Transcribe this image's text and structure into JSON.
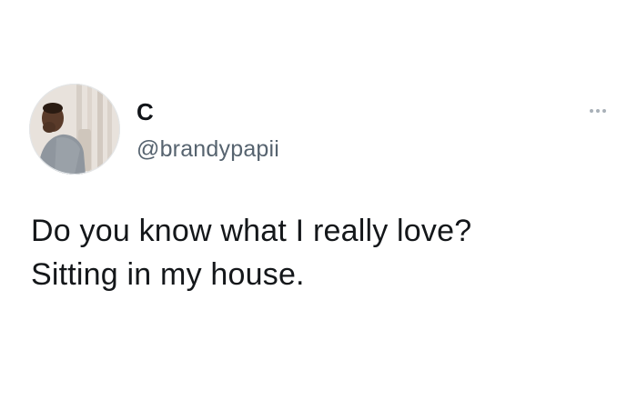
{
  "tweet": {
    "author": {
      "display_name": "C",
      "handle": "@brandypapii",
      "avatar_icon": "profile-photo-avatar"
    },
    "more_icon": "more-options-icon",
    "text_lines": [
      "Do you know what I really love?",
      "Sitting in my house."
    ]
  },
  "colors": {
    "background": "#ffffff",
    "name": "#111418",
    "handle": "#56636f",
    "text": "#14171a",
    "more_dots": "#a9b1b8"
  }
}
